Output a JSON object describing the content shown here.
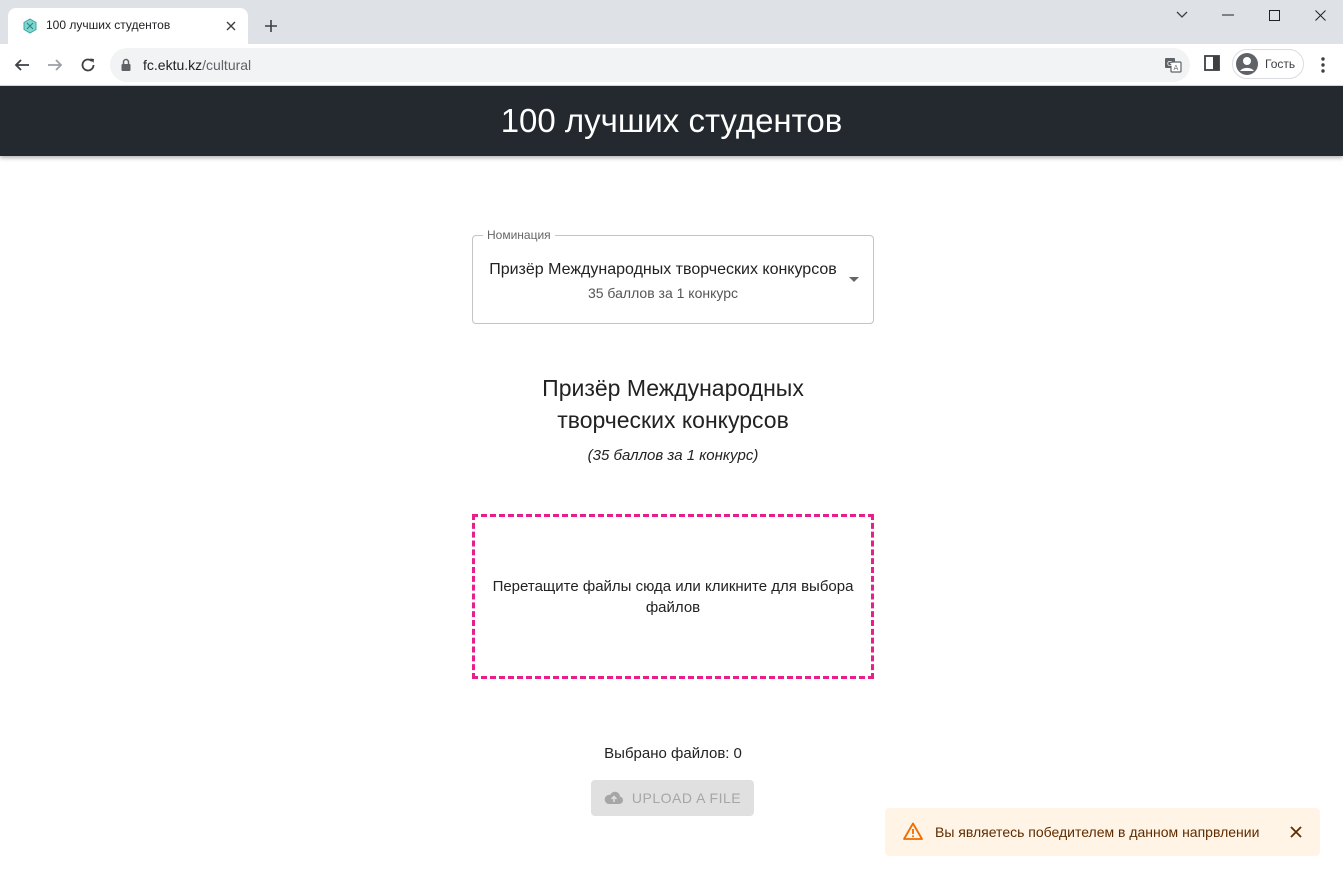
{
  "browser": {
    "tab_title": "100 лучших студентов",
    "url_host": "fc.ektu.kz",
    "url_path": "/cultural",
    "profile_label": "Гость"
  },
  "page": {
    "header_title": "100 лучших студентов",
    "nomination_select": {
      "label": "Номинация",
      "selected_title": "Призёр Международных творческих конкурсов",
      "selected_points": "35 баллов за 1 конкурс"
    },
    "nomination_heading": {
      "line1": "Призёр Международных",
      "line2": "творческих конкурсов",
      "points": "(35 баллов за 1 конкурс)"
    },
    "dropzone": {
      "line1": "Перетащите файлы сюда или кликните для выбора",
      "line2": "файлов"
    },
    "files_selected_label": "Выбрано файлов:",
    "files_selected_count": "0",
    "upload_button_label": "UPLOAD A FILE"
  },
  "toast": {
    "message": "Вы являетесь победителем в данном напрвлении",
    "severity_color": "#ed6c02",
    "background": "#fff4e5"
  },
  "colors": {
    "header_bg": "#24292f",
    "dropzone_border": "#e91e8c"
  }
}
